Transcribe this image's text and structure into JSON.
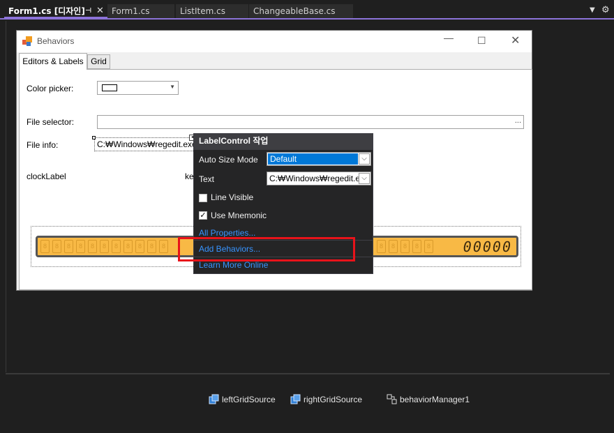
{
  "tabs": [
    {
      "label": "Form1.cs [디자인]",
      "active": true
    },
    {
      "label": "Form1.cs",
      "active": false
    },
    {
      "label": "ListItem.cs",
      "active": false
    },
    {
      "label": "ChangeableBase.cs",
      "active": false
    }
  ],
  "tab_icons": {
    "pin": "pin-icon",
    "close": "close-icon",
    "dropdown": "chevron-down-icon",
    "settings": "gear-icon"
  },
  "form": {
    "title": "Behaviors",
    "tab_pages": [
      "Editors & Labels",
      "Grid"
    ],
    "labels": {
      "color_picker": "Color picker:",
      "file_selector": "File selector:",
      "file_info": "File info:",
      "clock_label": "clockLabel",
      "key_partial": "ke"
    },
    "file_info_value": "C:₩Windows₩regedit.exe",
    "file_button": "...",
    "lcd_digits": "00000"
  },
  "smart_panel": {
    "title": "LabelControl 작업",
    "auto_size_label": "Auto Size Mode",
    "auto_size_value": "Default",
    "text_label": "Text",
    "text_value": "C:₩Windows₩regedit.exe",
    "line_visible_label": "Line Visible",
    "line_visible_checked": false,
    "use_mnemonic_label": "Use Mnemonic",
    "use_mnemonic_checked": true,
    "links": [
      "All Properties...",
      "Add Behaviors...",
      "Learn More Online"
    ]
  },
  "highlight_color": "#e8131a",
  "accent_color": "#8c73d9",
  "tray": [
    "leftGridSource",
    "rightGridSource",
    "behaviorManager1"
  ]
}
